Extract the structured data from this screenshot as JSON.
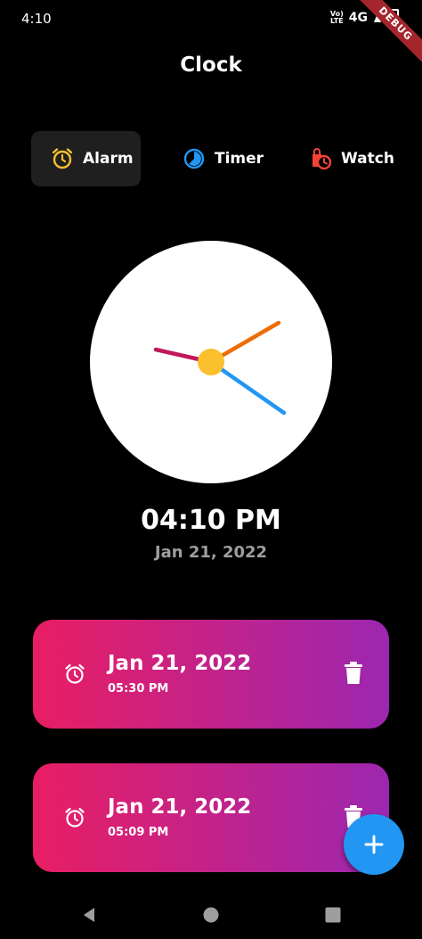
{
  "status_bar": {
    "time": "4:10",
    "volte_top": "Vo)",
    "volte_bottom": "LTE",
    "network": "4G",
    "debug_ribbon": "DEBUG"
  },
  "app": {
    "title": "Clock"
  },
  "tabs": [
    {
      "label": "Alarm",
      "icon": "alarm-clock-icon",
      "color": "#fbc02d",
      "active": true
    },
    {
      "label": "Timer",
      "icon": "timer-icon",
      "color": "#2196f3",
      "active": false
    },
    {
      "label": "Watch",
      "icon": "stopwatch-icon",
      "color": "#f44336",
      "active": false
    }
  ],
  "clock": {
    "time": "04:10 PM",
    "date": "Jan 21, 2022",
    "hour_hand_color": "#c2185b",
    "minute_hand_color": "#ef6c00",
    "second_hand_color": "#2196f3",
    "center_color": "#fbc02d"
  },
  "alarms": [
    {
      "date": "Jan 21, 2022",
      "time": "05:30 PM"
    },
    {
      "date": "Jan 21, 2022",
      "time": "05:09 PM"
    }
  ],
  "fab": {
    "icon": "plus-icon",
    "color": "#2196f3"
  },
  "nav": {
    "icons": [
      "back-icon",
      "home-icon",
      "recents-icon"
    ]
  }
}
